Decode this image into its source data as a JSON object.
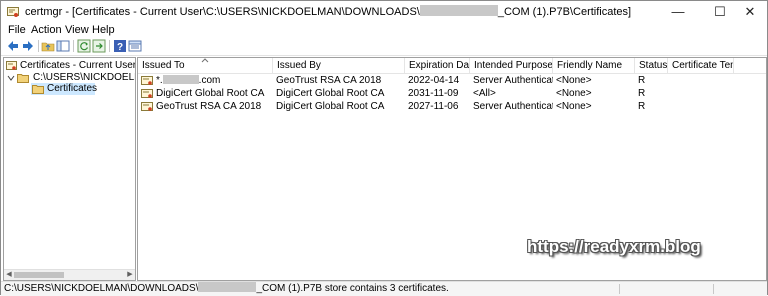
{
  "window": {
    "title_prefix": "certmgr - [Certificates - Current User\\C:\\USERS\\NICKDOELMAN\\DOWNLOADS\\",
    "title_suffix": "_COM (1).P7B\\Certificates]",
    "minimize": "—",
    "maximize": "☐",
    "close": "✕"
  },
  "menu": [
    "File",
    "Action",
    "View",
    "Help"
  ],
  "tree": {
    "root": "Certificates - Current User",
    "store": "C:\\USERS\\NICKDOELMAN\\DOWNLOADS\\",
    "folder": "Certificates"
  },
  "columns": [
    "Issued To",
    "Issued By",
    "Expiration Date",
    "Intended Purposes",
    "Friendly Name",
    "Status",
    "Certificate Tem..."
  ],
  "rows": [
    {
      "issued_to": "*.",
      "issued_to_suffix": ".com",
      "issued_by": "GeoTrust RSA CA 2018",
      "expiration": "2022-04-14",
      "purposes": "Server Authenticati...",
      "friendly": "<None>",
      "status": "R"
    },
    {
      "issued_to": "DigiCert Global Root CA",
      "issued_by": "DigiCert Global Root CA",
      "expiration": "2031-11-09",
      "purposes": "<All>",
      "friendly": "<None>",
      "status": "R"
    },
    {
      "issued_to": "GeoTrust RSA CA 2018",
      "issued_by": "DigiCert Global Root CA",
      "expiration": "2027-11-06",
      "purposes": "Server Authenticati...",
      "friendly": "<None>",
      "status": "R"
    }
  ],
  "statusbar": {
    "prefix": "C:\\USERS\\NICKDOELMAN\\DOWNLOADS\\",
    "suffix": "_COM (1).P7B store contains 3 certificates."
  },
  "watermark": "https://readyxrm.blog"
}
